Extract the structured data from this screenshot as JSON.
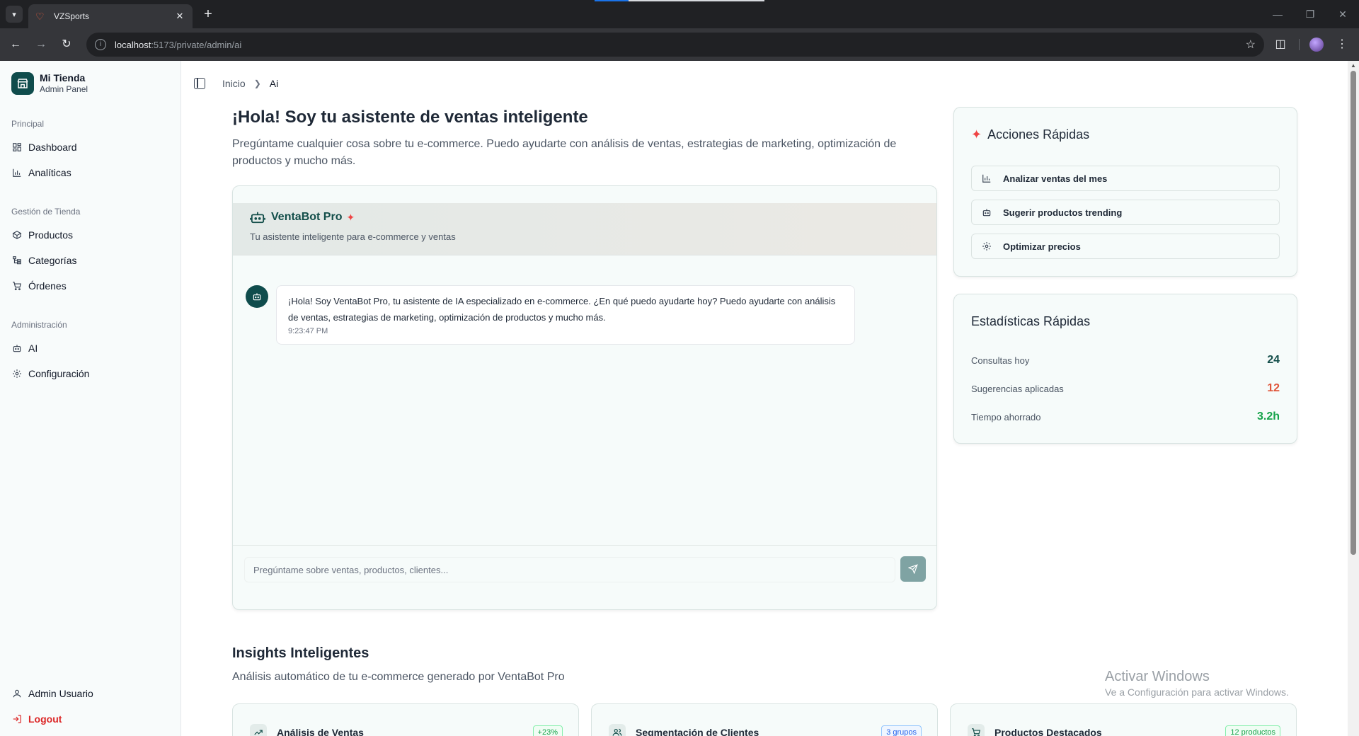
{
  "browser": {
    "tab_title": "VZSports",
    "url_host": "localhost",
    "url_rest": ":5173/private/admin/ai"
  },
  "sidebar": {
    "brand_name": "Mi Tienda",
    "brand_sub": "Admin Panel",
    "groups": [
      {
        "label": "Principal",
        "items": [
          {
            "label": "Dashboard",
            "icon": "grid-icon"
          },
          {
            "label": "Analíticas",
            "icon": "bar-chart-icon"
          }
        ]
      },
      {
        "label": "Gestión de Tienda",
        "items": [
          {
            "label": "Productos",
            "icon": "box-icon"
          },
          {
            "label": "Categorías",
            "icon": "folder-tree-icon"
          },
          {
            "label": "Órdenes",
            "icon": "cart-icon"
          }
        ]
      },
      {
        "label": "Administración",
        "items": [
          {
            "label": "AI",
            "icon": "bot-icon"
          },
          {
            "label": "Configuración",
            "icon": "gear-icon"
          }
        ]
      }
    ],
    "user_label": "Admin Usuario",
    "logout_label": "Logout"
  },
  "breadcrumb": {
    "home": "Inicio",
    "current": "Ai"
  },
  "hero": {
    "title": "¡Hola! Soy tu asistente de ventas inteligente",
    "subtitle": "Pregúntame cualquier cosa sobre tu e-commerce. Puedo ayudarte con análisis de ventas, estrategias de marketing, optimización de productos y mucho más."
  },
  "chat": {
    "bot_name": "VentaBot Pro",
    "bot_sub": "Tu asistente inteligente para e-commerce y ventas",
    "message": "¡Hola! Soy VentaBot Pro, tu asistente de IA especializado en e-commerce. ¿En qué puedo ayudarte hoy? Puedo ayudarte con análisis de ventas, estrategias de marketing, optimización de productos y mucho más.",
    "message_time": "9:23:47 PM",
    "input_placeholder": "Pregúntame sobre ventas, productos, clientes..."
  },
  "quick_actions": {
    "title": "Acciones Rápidas",
    "items": [
      {
        "label": "Analizar ventas del mes",
        "icon": "bar-chart-icon"
      },
      {
        "label": "Sugerir productos trending",
        "icon": "bot-icon"
      },
      {
        "label": "Optimizar precios",
        "icon": "gear-icon"
      }
    ]
  },
  "quick_stats": {
    "title": "Estadísticas Rápidas",
    "rows": [
      {
        "label": "Consultas hoy",
        "value": "24",
        "color": "#134e4a"
      },
      {
        "label": "Sugerencias aplicadas",
        "value": "12",
        "color": "#e0563b"
      },
      {
        "label": "Tiempo ahorrado",
        "value": "3.2h",
        "color": "#16a34a"
      }
    ]
  },
  "insights": {
    "title": "Insights Inteligentes",
    "subtitle": "Análisis automático de tu e-commerce generado por VentaBot Pro",
    "cards": [
      {
        "title": "Análisis de Ventas",
        "badge": "+23%",
        "icon": "trend-up-icon",
        "badge_color": "#16a34a"
      },
      {
        "title": "Segmentación de Clientes",
        "badge": "3 grupos",
        "icon": "users-icon",
        "badge_color": "#2563eb"
      },
      {
        "title": "Productos Destacados",
        "badge": "12 productos",
        "icon": "cart-icon",
        "badge_color": "#16a34a"
      }
    ]
  },
  "watermark": {
    "line1": "Activar Windows",
    "line2": "Ve a Configuración para activar Windows."
  }
}
